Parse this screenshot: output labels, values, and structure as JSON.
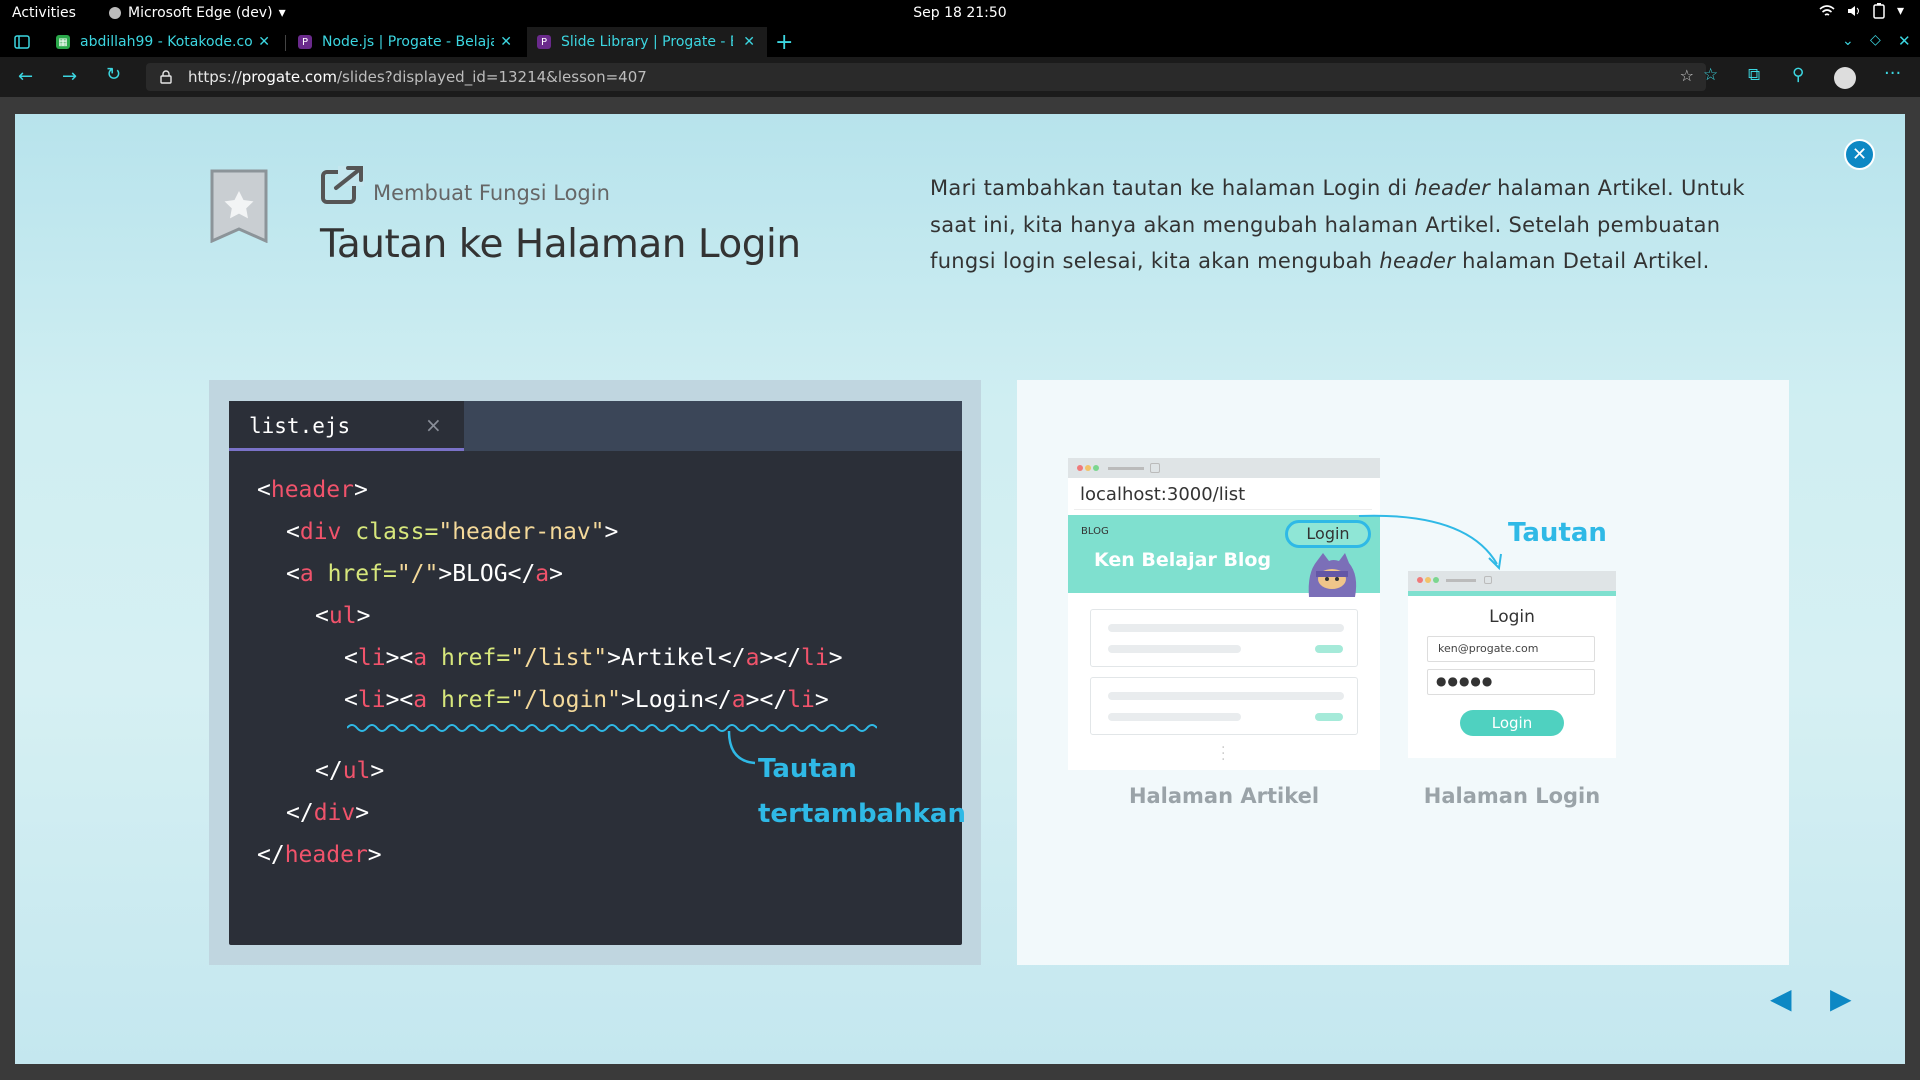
{
  "system": {
    "activities": "Activities",
    "app_name": "Microsoft Edge (dev)",
    "clock": "Sep 18  21:50"
  },
  "tabs": [
    {
      "title": "abdillah99 - Kotakode.com",
      "favicon_color": "#2aa84a"
    },
    {
      "title": "Node.js | Progate - Belajar",
      "favicon_color": "#6a2a8c"
    },
    {
      "title": "Slide Library | Progate - Bel",
      "favicon_color": "#6a2a8c",
      "active": true
    }
  ],
  "address": {
    "scheme": "https://",
    "domain": "progate.com",
    "path": "/slides?displayed_id=13214&lesson=407"
  },
  "slide": {
    "section_label": "Membuat Fungsi Login",
    "title": "Tautan ke Halaman Login",
    "desc_1": "Mari tambahkan tautan ke halaman Login di ",
    "desc_em1": "header",
    "desc_2": " halaman Artikel. Untuk saat ini, kita hanya akan mengubah halaman Artikel. Setelah pembuatan fungsi login selesai, kita akan mengubah ",
    "desc_em2": "header",
    "desc_3": " halaman Detail Artikel."
  },
  "code": {
    "filename": "list.ejs",
    "close_glyph": "×",
    "lines": [
      {
        "pre": "<",
        "tag": "header",
        "post": ">"
      },
      {
        "pre": "<",
        "tag": "div",
        "attr": " class=",
        "str": "\"header-nav\"",
        "post": ">"
      },
      {
        "pre": "<",
        "tag": "a",
        "attr": " href=",
        "str": "\"/\"",
        "text": ">BLOG</",
        "tag2": "a",
        "post": ">"
      },
      {
        "pre": "<",
        "tag": "ul",
        "post": ">"
      },
      {
        "pre": "<",
        "tag": "li",
        "mid": "><",
        "tag_b": "a",
        "attr": " href=",
        "str": "\"/list\"",
        "text": ">Artikel</",
        "tag2": "a",
        "mid2": "></",
        "tag3": "li",
        "post": ">"
      },
      {
        "pre": "<",
        "tag": "li",
        "mid": "><",
        "tag_b": "a",
        "attr": " href=",
        "str": "\"/login\"",
        "text": ">Login</",
        "tag2": "a",
        "mid2": "></",
        "tag3": "li",
        "post": ">"
      },
      {
        "pre": "</",
        "tag": "ul",
        "post": ">"
      },
      {
        "pre": "</",
        "tag": "div",
        "post": ">"
      },
      {
        "pre": "</",
        "tag": "header",
        "post": ">"
      }
    ],
    "annotation_1": "Tautan",
    "annotation_2": "tertambahkan"
  },
  "illustration": {
    "url_text": "localhost:3000/list",
    "blog_tag": "BLOG",
    "blog_title": "Ken Belajar Blog",
    "login_link": "Login",
    "arrow_label": "Tautan",
    "login_page_title": "Login",
    "email_value": "ken@progate.com",
    "password_value": "●●●●●",
    "login_button": "Login",
    "caption_left": "Halaman Artikel",
    "caption_right": "Halaman Login",
    "colors": {
      "accent": "#5fd7c4",
      "link": "#2fb9e6"
    }
  }
}
